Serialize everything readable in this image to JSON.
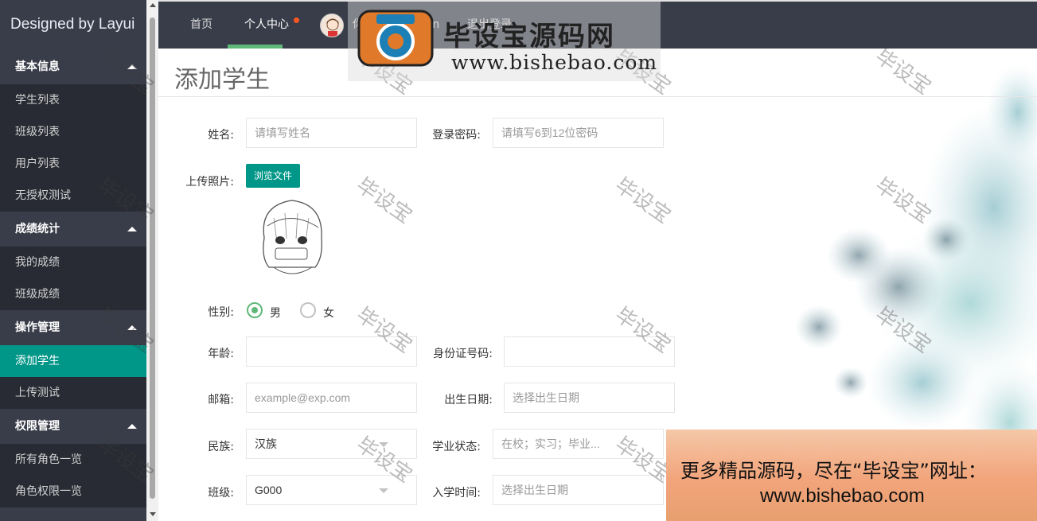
{
  "app": {
    "logo": "Designed by Layui"
  },
  "sidebar": {
    "groups": [
      {
        "label": "基本信息",
        "items": [
          "学生列表",
          "班级列表",
          "用户列表",
          "无授权测试"
        ]
      },
      {
        "label": "成绩统计",
        "items": [
          "我的成绩",
          "班级成绩"
        ]
      },
      {
        "label": "操作管理",
        "items": [
          "添加学生",
          "上传测试"
        ]
      },
      {
        "label": "权限管理",
        "items": [
          "所有角色一览",
          "角色权限一览"
        ]
      }
    ],
    "active_item": "添加学生"
  },
  "header": {
    "home": "首页",
    "personal_center": "个人中心",
    "greeting": "你好，zhangsan",
    "logout": "退出登录"
  },
  "page": {
    "title": "添加学生"
  },
  "form": {
    "name": {
      "label": "姓名:",
      "placeholder": "请填写姓名"
    },
    "password": {
      "label": "登录密码:",
      "placeholder": "请填写6到12位密码"
    },
    "photo": {
      "label": "上传照片:",
      "button": "浏览文件"
    },
    "gender": {
      "label": "性别:",
      "options": [
        "男",
        "女"
      ],
      "selected": "男"
    },
    "age": {
      "label": "年龄:",
      "value": ""
    },
    "id_number": {
      "label": "身份证号码:",
      "value": ""
    },
    "email": {
      "label": "邮箱:",
      "placeholder": "example@exp.com"
    },
    "birth_date": {
      "label": "出生日期:",
      "placeholder": "选择出生日期"
    },
    "ethnicity": {
      "label": "民族:",
      "value": "汉族"
    },
    "study_status": {
      "label": "学业状态:",
      "placeholder": "在校；实习；毕业..."
    },
    "class": {
      "label": "班级:",
      "value": "G000"
    },
    "enroll_date": {
      "label": "入学时间:",
      "placeholder": "选择出生日期"
    }
  },
  "watermark": {
    "logo_cn": "毕设宝源码网",
    "logo_url": "www.bishebao.com",
    "tile_text": "毕设宝",
    "banner_line1": "更多精品源码，尽在“毕设宝”网址：",
    "banner_line2": "www.bishebao.com"
  },
  "colors": {
    "sidebar_bg": "#393D49",
    "sidebar_item_bg": "#282B33",
    "accent": "#009688",
    "radio_checked": "#5FB878",
    "badge_dot": "#FF5722"
  }
}
